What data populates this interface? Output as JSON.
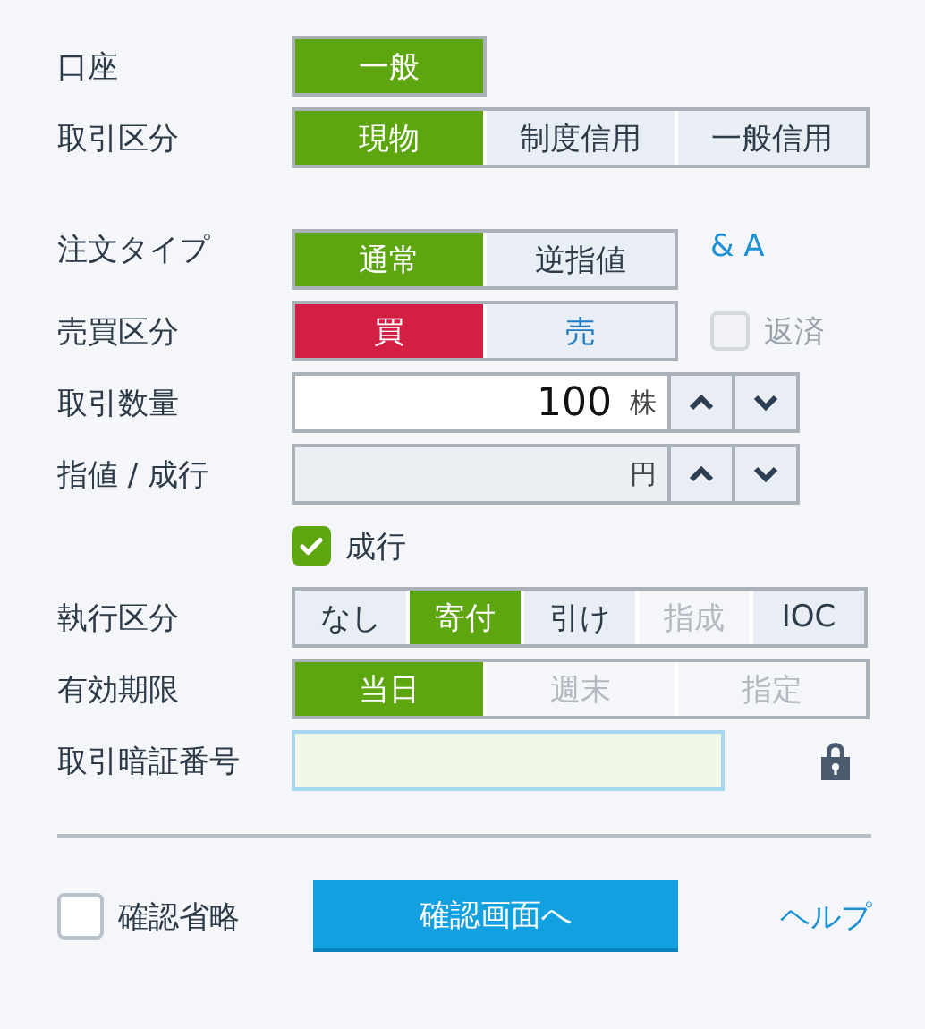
{
  "sections": [
    {
      "rows": [
        {
          "kind": "segments",
          "label": "口座",
          "segments": [
            {
              "label": "一般",
              "selected": true,
              "disabled": false
            }
          ]
        },
        {
          "kind": "segments",
          "label": "取引区分",
          "segments": [
            {
              "label": "現物",
              "selected": true,
              "disabled": false
            },
            {
              "label": "制度信用",
              "selected": false,
              "disabled": false
            },
            {
              "label": "一般信用",
              "selected": false,
              "disabled": false
            }
          ]
        }
      ]
    },
    {
      "rows": [
        {
          "kind": "segments",
          "label": "注文タイプ",
          "segments": [
            {
              "label": "通常",
              "selected": true,
              "disabled": false
            },
            {
              "label": "逆指値",
              "selected": false,
              "disabled": false
            }
          ],
          "link": "& A"
        },
        {
          "kind": "segments",
          "label": "売買区分",
          "segments": [
            {
              "label": "買",
              "selected": true,
              "disabled": false,
              "color": "#d41f45"
            },
            {
              "label": "売",
              "selected": false,
              "disabled": false,
              "color": "#1f7cc4"
            }
          ],
          "side_checkbox": {
            "label": "返済",
            "checked": false,
            "disabled": true
          }
        },
        {
          "kind": "stepper",
          "label": "取引数量",
          "value": "100",
          "unit": "株",
          "disabled": false
        },
        {
          "kind": "stepper",
          "label": "指値 / 成行",
          "unit": "円",
          "disabled": true
        },
        {
          "kind": "checkbox",
          "label": "成行",
          "checked": true
        },
        {
          "kind": "segments",
          "label": "執行区分",
          "segments": [
            {
              "label": "なし",
              "selected": false,
              "disabled": false
            },
            {
              "label": "寄付",
              "selected": true,
              "disabled": false
            },
            {
              "label": "引け",
              "selected": false,
              "disabled": false
            },
            {
              "label": "指成",
              "selected": false,
              "disabled": true
            },
            {
              "label": "IOC",
              "selected": false,
              "disabled": false
            }
          ]
        },
        {
          "kind": "segments",
          "label": "有効期限",
          "segments": [
            {
              "label": "当日",
              "selected": true,
              "disabled": false
            },
            {
              "label": "週末",
              "selected": false,
              "disabled": true
            },
            {
              "label": "指定",
              "selected": false,
              "disabled": true
            }
          ]
        },
        {
          "kind": "password",
          "label": "取引暗証番号"
        }
      ]
    }
  ],
  "footer": {
    "checkbox": {
      "label": "確認省略",
      "checked": false
    },
    "submit": "確認画面へ",
    "help": "ヘルプ"
  }
}
